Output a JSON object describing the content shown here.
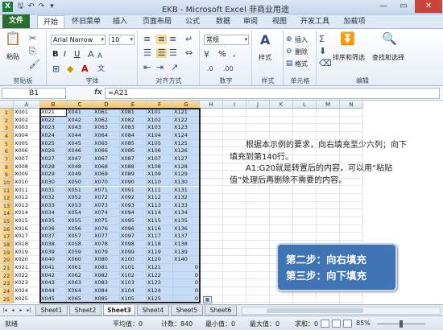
{
  "title": "EKB - Microsoft Excel 非商业用途",
  "qat": {
    "app": "X",
    "save": "🖫",
    "undo": "↶",
    "redo": "↷",
    "custom": "▾"
  },
  "window": {
    "min": "—",
    "max": "▭",
    "close": "✕"
  },
  "tabs": [
    "开始",
    "怀旧菜单",
    "插入",
    "页面布局",
    "公式",
    "数据",
    "审阅",
    "视图",
    "开发工具",
    "加载项"
  ],
  "file_tab": "文件",
  "ribbon": {
    "clipboard": {
      "label": "剪贴板",
      "paste": "粘贴"
    },
    "font": {
      "label": "字体",
      "name": "Arial Narrow",
      "size": "10",
      "bold": "B",
      "italic": "I",
      "underline": "U"
    },
    "align": {
      "label": "对齐方式"
    },
    "number": {
      "label": "数字",
      "format": "常规",
      "percent": "%",
      "comma": ","
    },
    "style": {
      "label": "样式",
      "name": "样式"
    },
    "cells": {
      "label": "单元格",
      "insert": "插入",
      "delete": "删除",
      "format": "格式"
    },
    "edit": {
      "label": "编辑",
      "sort": "排序和筛选",
      "find": "查找和选择"
    }
  },
  "formula": {
    "namebox": "B1",
    "fx": "fx",
    "value": "=A21"
  },
  "columns": [
    "A",
    "B",
    "C",
    "D",
    "E",
    "F",
    "G",
    "H",
    "I",
    "J",
    "K",
    "L",
    "M",
    "N"
  ],
  "rows": [
    "1",
    "2",
    "3",
    "4",
    "5",
    "6",
    "7",
    "8",
    "9",
    "10",
    "11",
    "12",
    "13",
    "14",
    "15",
    "16",
    "17",
    "18",
    "19",
    "20",
    "21",
    "22",
    "23",
    "24",
    "25"
  ],
  "cells": {
    "A": [
      "X001",
      "X002",
      "X003",
      "X004",
      "X005",
      "X006",
      "X007",
      "X008",
      "X009",
      "X010",
      "X011",
      "X012",
      "X013",
      "X014",
      "X015",
      "X016",
      "X017",
      "X018",
      "X019",
      "X020",
      "X021",
      "X022",
      "X023",
      "X024",
      "X025"
    ],
    "B": [
      "X021",
      "X022",
      "X023",
      "X024",
      "X025",
      "X026",
      "X027",
      "X028",
      "X029",
      "X030",
      "X031",
      "X032",
      "X033",
      "X034",
      "X035",
      "X036",
      "X037",
      "X038",
      "X039",
      "X040",
      "X041",
      "X042",
      "X043",
      "X044",
      "X045"
    ],
    "C": [
      "X041",
      "X042",
      "X043",
      "X044",
      "X045",
      "X046",
      "X047",
      "X048",
      "X049",
      "X050",
      "X051",
      "X052",
      "X053",
      "X054",
      "X055",
      "X056",
      "X057",
      "X058",
      "X059",
      "X060",
      "X061",
      "X062",
      "X063",
      "X064",
      "X065"
    ],
    "D": [
      "X061",
      "X062",
      "X063",
      "X064",
      "X065",
      "X066",
      "X067",
      "X068",
      "X069",
      "X070",
      "X071",
      "X072",
      "X073",
      "X074",
      "X075",
      "X076",
      "X077",
      "X078",
      "X079",
      "X080",
      "X081",
      "X082",
      "X083",
      "X084",
      "X085"
    ],
    "E": [
      "X081",
      "X082",
      "X083",
      "X084",
      "X085",
      "X086",
      "X087",
      "X088",
      "X089",
      "X090",
      "X091",
      "X092",
      "X093",
      "X094",
      "X095",
      "X096",
      "X097",
      "X098",
      "X099",
      "X100",
      "X101",
      "X102",
      "X103",
      "X104",
      "X105"
    ],
    "F": [
      "X101",
      "X102",
      "X103",
      "X104",
      "X105",
      "X106",
      "X107",
      "X108",
      "X109",
      "X110",
      "X111",
      "X112",
      "X113",
      "X114",
      "X115",
      "X116",
      "X117",
      "X118",
      "X119",
      "X120",
      "X121",
      "X122",
      "X123",
      "X124",
      "X125"
    ],
    "G": [
      "X121",
      "X122",
      "X123",
      "X124",
      "X125",
      "X126",
      "X127",
      "X128",
      "X129",
      "X130",
      "X131",
      "X132",
      "X133",
      "X134",
      "X135",
      "X136",
      "X137",
      "X138",
      "X139",
      "X140",
      "0",
      "0",
      "0",
      "0",
      "0"
    ]
  },
  "textbox": {
    "p1": "根据本示例的要求，向右填充至少六列；向下填充到第140行。",
    "p2": "A1:G20就是转置后的内容，可以用“粘贴值”处理后再删除不需要的内容。"
  },
  "callout": {
    "line1": "第二步：向右填充",
    "line2": "第三步：向下填充"
  },
  "sheets": [
    "Sheet1",
    "Sheet2",
    "Sheet3",
    "Sheet4",
    "Sheet5",
    "Sheet6"
  ],
  "active_sheet": "Sheet3",
  "status": {
    "mode": "就绪",
    "avg": "平均值：0",
    "count": "计数：840",
    "min": "最小值：0",
    "max": "最大值：0",
    "sum": "求和：0",
    "zoom": "85%"
  }
}
